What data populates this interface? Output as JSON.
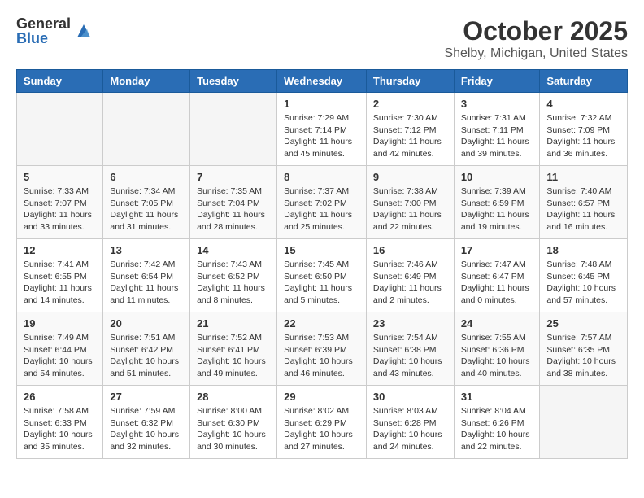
{
  "logo": {
    "general": "General",
    "blue": "Blue"
  },
  "title": "October 2025",
  "location": "Shelby, Michigan, United States",
  "headers": [
    "Sunday",
    "Monday",
    "Tuesday",
    "Wednesday",
    "Thursday",
    "Friday",
    "Saturday"
  ],
  "weeks": [
    [
      {
        "day": "",
        "info": ""
      },
      {
        "day": "",
        "info": ""
      },
      {
        "day": "",
        "info": ""
      },
      {
        "day": "1",
        "info": "Sunrise: 7:29 AM\nSunset: 7:14 PM\nDaylight: 11 hours and 45 minutes."
      },
      {
        "day": "2",
        "info": "Sunrise: 7:30 AM\nSunset: 7:12 PM\nDaylight: 11 hours and 42 minutes."
      },
      {
        "day": "3",
        "info": "Sunrise: 7:31 AM\nSunset: 7:11 PM\nDaylight: 11 hours and 39 minutes."
      },
      {
        "day": "4",
        "info": "Sunrise: 7:32 AM\nSunset: 7:09 PM\nDaylight: 11 hours and 36 minutes."
      }
    ],
    [
      {
        "day": "5",
        "info": "Sunrise: 7:33 AM\nSunset: 7:07 PM\nDaylight: 11 hours and 33 minutes."
      },
      {
        "day": "6",
        "info": "Sunrise: 7:34 AM\nSunset: 7:05 PM\nDaylight: 11 hours and 31 minutes."
      },
      {
        "day": "7",
        "info": "Sunrise: 7:35 AM\nSunset: 7:04 PM\nDaylight: 11 hours and 28 minutes."
      },
      {
        "day": "8",
        "info": "Sunrise: 7:37 AM\nSunset: 7:02 PM\nDaylight: 11 hours and 25 minutes."
      },
      {
        "day": "9",
        "info": "Sunrise: 7:38 AM\nSunset: 7:00 PM\nDaylight: 11 hours and 22 minutes."
      },
      {
        "day": "10",
        "info": "Sunrise: 7:39 AM\nSunset: 6:59 PM\nDaylight: 11 hours and 19 minutes."
      },
      {
        "day": "11",
        "info": "Sunrise: 7:40 AM\nSunset: 6:57 PM\nDaylight: 11 hours and 16 minutes."
      }
    ],
    [
      {
        "day": "12",
        "info": "Sunrise: 7:41 AM\nSunset: 6:55 PM\nDaylight: 11 hours and 14 minutes."
      },
      {
        "day": "13",
        "info": "Sunrise: 7:42 AM\nSunset: 6:54 PM\nDaylight: 11 hours and 11 minutes."
      },
      {
        "day": "14",
        "info": "Sunrise: 7:43 AM\nSunset: 6:52 PM\nDaylight: 11 hours and 8 minutes."
      },
      {
        "day": "15",
        "info": "Sunrise: 7:45 AM\nSunset: 6:50 PM\nDaylight: 11 hours and 5 minutes."
      },
      {
        "day": "16",
        "info": "Sunrise: 7:46 AM\nSunset: 6:49 PM\nDaylight: 11 hours and 2 minutes."
      },
      {
        "day": "17",
        "info": "Sunrise: 7:47 AM\nSunset: 6:47 PM\nDaylight: 11 hours and 0 minutes."
      },
      {
        "day": "18",
        "info": "Sunrise: 7:48 AM\nSunset: 6:45 PM\nDaylight: 10 hours and 57 minutes."
      }
    ],
    [
      {
        "day": "19",
        "info": "Sunrise: 7:49 AM\nSunset: 6:44 PM\nDaylight: 10 hours and 54 minutes."
      },
      {
        "day": "20",
        "info": "Sunrise: 7:51 AM\nSunset: 6:42 PM\nDaylight: 10 hours and 51 minutes."
      },
      {
        "day": "21",
        "info": "Sunrise: 7:52 AM\nSunset: 6:41 PM\nDaylight: 10 hours and 49 minutes."
      },
      {
        "day": "22",
        "info": "Sunrise: 7:53 AM\nSunset: 6:39 PM\nDaylight: 10 hours and 46 minutes."
      },
      {
        "day": "23",
        "info": "Sunrise: 7:54 AM\nSunset: 6:38 PM\nDaylight: 10 hours and 43 minutes."
      },
      {
        "day": "24",
        "info": "Sunrise: 7:55 AM\nSunset: 6:36 PM\nDaylight: 10 hours and 40 minutes."
      },
      {
        "day": "25",
        "info": "Sunrise: 7:57 AM\nSunset: 6:35 PM\nDaylight: 10 hours and 38 minutes."
      }
    ],
    [
      {
        "day": "26",
        "info": "Sunrise: 7:58 AM\nSunset: 6:33 PM\nDaylight: 10 hours and 35 minutes."
      },
      {
        "day": "27",
        "info": "Sunrise: 7:59 AM\nSunset: 6:32 PM\nDaylight: 10 hours and 32 minutes."
      },
      {
        "day": "28",
        "info": "Sunrise: 8:00 AM\nSunset: 6:30 PM\nDaylight: 10 hours and 30 minutes."
      },
      {
        "day": "29",
        "info": "Sunrise: 8:02 AM\nSunset: 6:29 PM\nDaylight: 10 hours and 27 minutes."
      },
      {
        "day": "30",
        "info": "Sunrise: 8:03 AM\nSunset: 6:28 PM\nDaylight: 10 hours and 24 minutes."
      },
      {
        "day": "31",
        "info": "Sunrise: 8:04 AM\nSunset: 6:26 PM\nDaylight: 10 hours and 22 minutes."
      },
      {
        "day": "",
        "info": ""
      }
    ]
  ]
}
